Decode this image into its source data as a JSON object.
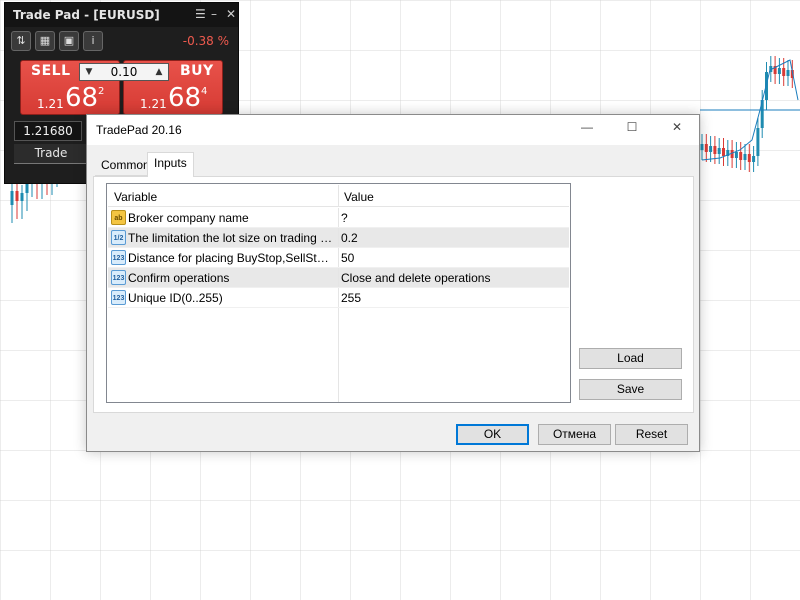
{
  "chart_background": {
    "description_icon": "candlestick-chart",
    "colors": {
      "up": "#1e8bb0",
      "down": "#d93a35",
      "ma": "#1b7dbd"
    }
  },
  "trade_pad": {
    "title": "Trade Pad - [EURUSD]",
    "toolbar_icons": [
      "arrows-icon",
      "calculator-icon",
      "calendar-icon",
      "info-icon"
    ],
    "change": "-0.38 %",
    "sell": {
      "label": "SELL",
      "price_small": "1.21",
      "price_big": "68",
      "price_sup": "2"
    },
    "buy": {
      "label": "BUY",
      "price_small": "1.21",
      "price_big": "68",
      "price_sup": "4"
    },
    "lot": "0.10",
    "price_field": "1.21680",
    "trade_button": "Trade",
    "accent_color": "#e0463f"
  },
  "dialog": {
    "title": "TradePad 20.16",
    "tabs": [
      {
        "label": "Common",
        "active": false
      },
      {
        "label": "Inputs",
        "active": true
      }
    ],
    "grid": {
      "headers": [
        "Variable",
        "Value"
      ],
      "rows": [
        {
          "icon": "ab",
          "icon_type": "text",
          "variable": "Broker company name",
          "value": "?"
        },
        {
          "icon": "1/2",
          "icon_type": "double",
          "variable": "The limitation the lot size on trading sym...",
          "value": "0.2"
        },
        {
          "icon": "123",
          "icon_type": "int",
          "variable": "Distance for placing BuyStop,SellStop or...",
          "value": "50"
        },
        {
          "icon": "123",
          "icon_type": "int",
          "variable": "Confirm operations",
          "value": "Close and delete operations"
        },
        {
          "icon": "123",
          "icon_type": "int",
          "variable": "Unique ID(0..255)",
          "value": "255"
        }
      ]
    },
    "side_buttons": {
      "load": "Load",
      "save": "Save"
    },
    "bottom_buttons": {
      "ok": "OK",
      "cancel": "Отмена",
      "reset": "Reset"
    }
  }
}
